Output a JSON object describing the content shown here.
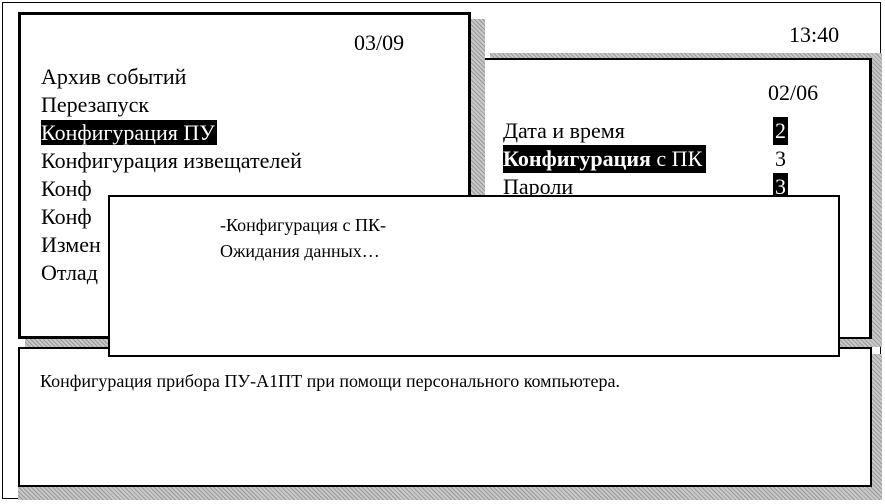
{
  "clock": "13:40",
  "main_menu": {
    "counter": "03/09",
    "items": [
      {
        "label": "Архив событий",
        "selected": false
      },
      {
        "label": "Перезапуск",
        "selected": false
      },
      {
        "label": "Конфигурация ПУ",
        "selected": true
      },
      {
        "label": "Конфигурация извещателей",
        "selected": false
      },
      {
        "label": "Конф",
        "selected": false
      },
      {
        "label": "Конф",
        "selected": false
      },
      {
        "label": "Измен",
        "selected": false
      },
      {
        "label": "Отлад",
        "selected": false
      }
    ]
  },
  "sub_menu": {
    "counter": "02/06",
    "items": [
      {
        "label": "Дата и время",
        "value": "2",
        "selected": false
      },
      {
        "label_bold": "Конфигурация",
        "label_rest": " с ПК",
        "value": "3",
        "selected": true
      },
      {
        "label": "Пароли",
        "value": "3",
        "selected": false
      }
    ]
  },
  "dialog": {
    "title": "-Конфигурация с ПК-",
    "message": "Ожидания данных…"
  },
  "description": "Конфигурация прибора ПУ-А1ПТ при помощи персонального компьютера."
}
